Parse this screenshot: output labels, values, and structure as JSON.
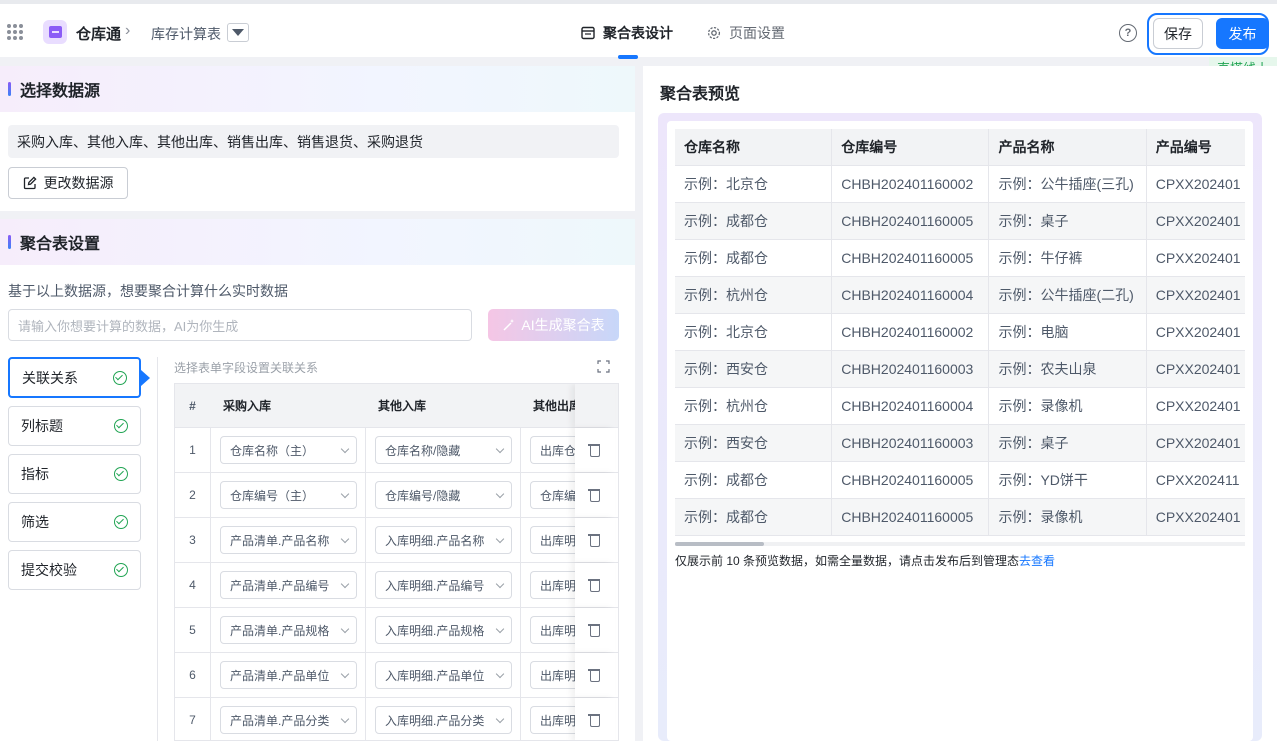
{
  "header": {
    "app_name": "仓库通",
    "crumb": "库存计算表",
    "tabs": [
      {
        "label": "聚合表设计"
      },
      {
        "label": "页面设置"
      }
    ],
    "help": "?",
    "save_label": "保存",
    "publish_label": "发布",
    "live_tag": "直搭线上"
  },
  "datasource": {
    "title": "选择数据源",
    "sources_text": "采购入库、其他入库、其他出库、销售出库、销售退货、采购退货",
    "change_label": "更改数据源"
  },
  "aggregate": {
    "title": "聚合表设置",
    "desc": "基于以上数据源，想要聚合计算什么实时数据",
    "input_placeholder": "请输入你想要计算的数据，AI为你生成",
    "ai_label": "AI生成聚合表",
    "steps": [
      {
        "label": "关联关系"
      },
      {
        "label": "列标题"
      },
      {
        "label": "指标"
      },
      {
        "label": "筛选"
      },
      {
        "label": "提交校验"
      }
    ],
    "mapping_hint": "选择表单字段设置关联关系",
    "columns": [
      "#",
      "采购入库",
      "其他入库",
      "其他出库"
    ],
    "rows": [
      {
        "idx": "1",
        "a": "仓库名称（主）",
        "b": "仓库名称/隐藏",
        "c": "出库仓库"
      },
      {
        "idx": "2",
        "a": "仓库编号（主）",
        "b": "仓库编号/隐藏",
        "c": "仓库编号"
      },
      {
        "idx": "3",
        "a": "产品清单.产品名称",
        "b": "入库明细.产品名称",
        "c": "出库明细"
      },
      {
        "idx": "4",
        "a": "产品清单.产品编号",
        "b": "入库明细.产品编号",
        "c": "出库明细"
      },
      {
        "idx": "5",
        "a": "产品清单.产品规格",
        "b": "入库明细.产品规格",
        "c": "出库明细"
      },
      {
        "idx": "6",
        "a": "产品清单.产品单位",
        "b": "入库明细.产品单位",
        "c": "出库明细"
      },
      {
        "idx": "7",
        "a": "产品清单.产品分类",
        "b": "入库明细.产品分类",
        "c": "出库明细"
      }
    ]
  },
  "preview": {
    "title": "聚合表预览",
    "columns": [
      "仓库名称",
      "仓库编号",
      "产品名称",
      "产品编号"
    ],
    "rows": [
      [
        "示例：北京仓",
        "CHBH202401160002",
        "示例：公牛插座(三孔)",
        "CPXX202401"
      ],
      [
        "示例：成都仓",
        "CHBH202401160005",
        "示例：桌子",
        "CPXX202401"
      ],
      [
        "示例：成都仓",
        "CHBH202401160005",
        "示例：牛仔裤",
        "CPXX202401"
      ],
      [
        "示例：杭州仓",
        "CHBH202401160004",
        "示例：公牛插座(二孔)",
        "CPXX202401"
      ],
      [
        "示例：北京仓",
        "CHBH202401160002",
        "示例：电脑",
        "CPXX202401"
      ],
      [
        "示例：西安仓",
        "CHBH202401160003",
        "示例：农夫山泉",
        "CPXX202401"
      ],
      [
        "示例：杭州仓",
        "CHBH202401160004",
        "示例：录像机",
        "CPXX202401"
      ],
      [
        "示例：西安仓",
        "CHBH202401160003",
        "示例：桌子",
        "CPXX202401"
      ],
      [
        "示例：成都仓",
        "CHBH202401160005",
        "示例：YD饼干",
        "CPXX202411"
      ],
      [
        "示例：成都仓",
        "CHBH202401160005",
        "示例：录像机",
        "CPXX202401"
      ]
    ],
    "note_text": "仅展示前 10 条预览数据，如需全量数据，请点击发布后到管理态",
    "note_link": "去查看"
  },
  "colors": {
    "accent": "#1677ff",
    "success": "#21a453",
    "brand": "#8b5cf6"
  }
}
